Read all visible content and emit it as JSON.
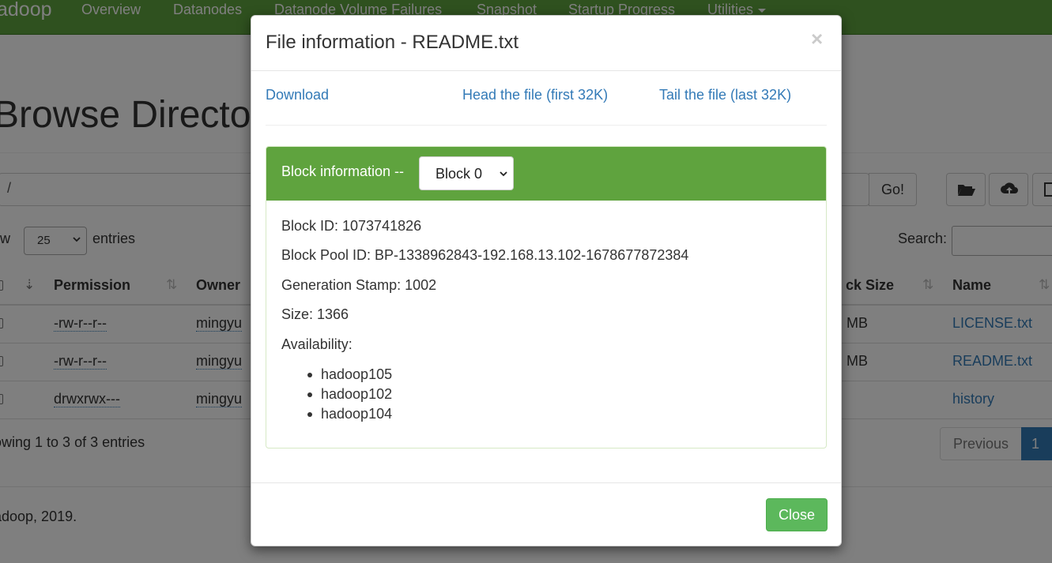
{
  "navbar": {
    "brand": "adoop",
    "items": [
      "Overview",
      "Datanodes",
      "Datanode Volume Failures",
      "Snapshot",
      "Startup Progress",
      "Utilities"
    ]
  },
  "page": {
    "title": "Browse Director",
    "path_value": "/",
    "go_label": "Go!",
    "show_label": "ow",
    "entries_value": "25",
    "entries_label": "entries",
    "search_label": "Search:",
    "info": "owing 1 to 3 of 3 entries",
    "pagination": {
      "previous": "Previous",
      "current": "1"
    },
    "footer": "adoop, 2019."
  },
  "table": {
    "headers": {
      "permission": "Permission",
      "owner": "Owner",
      "block_size": "ck Size",
      "name": "Name"
    },
    "rows": [
      {
        "permission": "-rw-r--r--",
        "owner": "mingyu",
        "block_size": "MB",
        "name": "LICENSE.txt"
      },
      {
        "permission": "-rw-r--r--",
        "owner": "mingyu",
        "block_size": "MB",
        "name": "README.txt"
      },
      {
        "permission": "drwxrwx---",
        "owner": "mingyu",
        "block_size": "",
        "name": "history"
      }
    ]
  },
  "modal": {
    "title": "File information - README.txt",
    "close_x": "×",
    "links": {
      "download": "Download",
      "head": "Head the file (first 32K)",
      "tail": "Tail the file (last 32K)"
    },
    "panel": {
      "heading": "Block information --",
      "selected_block": "Block 0",
      "block_id": "Block ID: 1073741826",
      "block_pool_id": "Block Pool ID: BP-1338962843-192.168.13.102-1678677872384",
      "generation_stamp": "Generation Stamp: 1002",
      "size": "Size: 1366",
      "availability_label": "Availability:",
      "availability": [
        "hadoop105",
        "hadoop102",
        "hadoop104"
      ]
    },
    "close_button": "Close"
  },
  "colors": {
    "navbar": "#5fa33e",
    "panel_heading": "#5fa33e",
    "link": "#337ab7",
    "close_button": "#5cb85c",
    "active_page": "#337ab7"
  }
}
